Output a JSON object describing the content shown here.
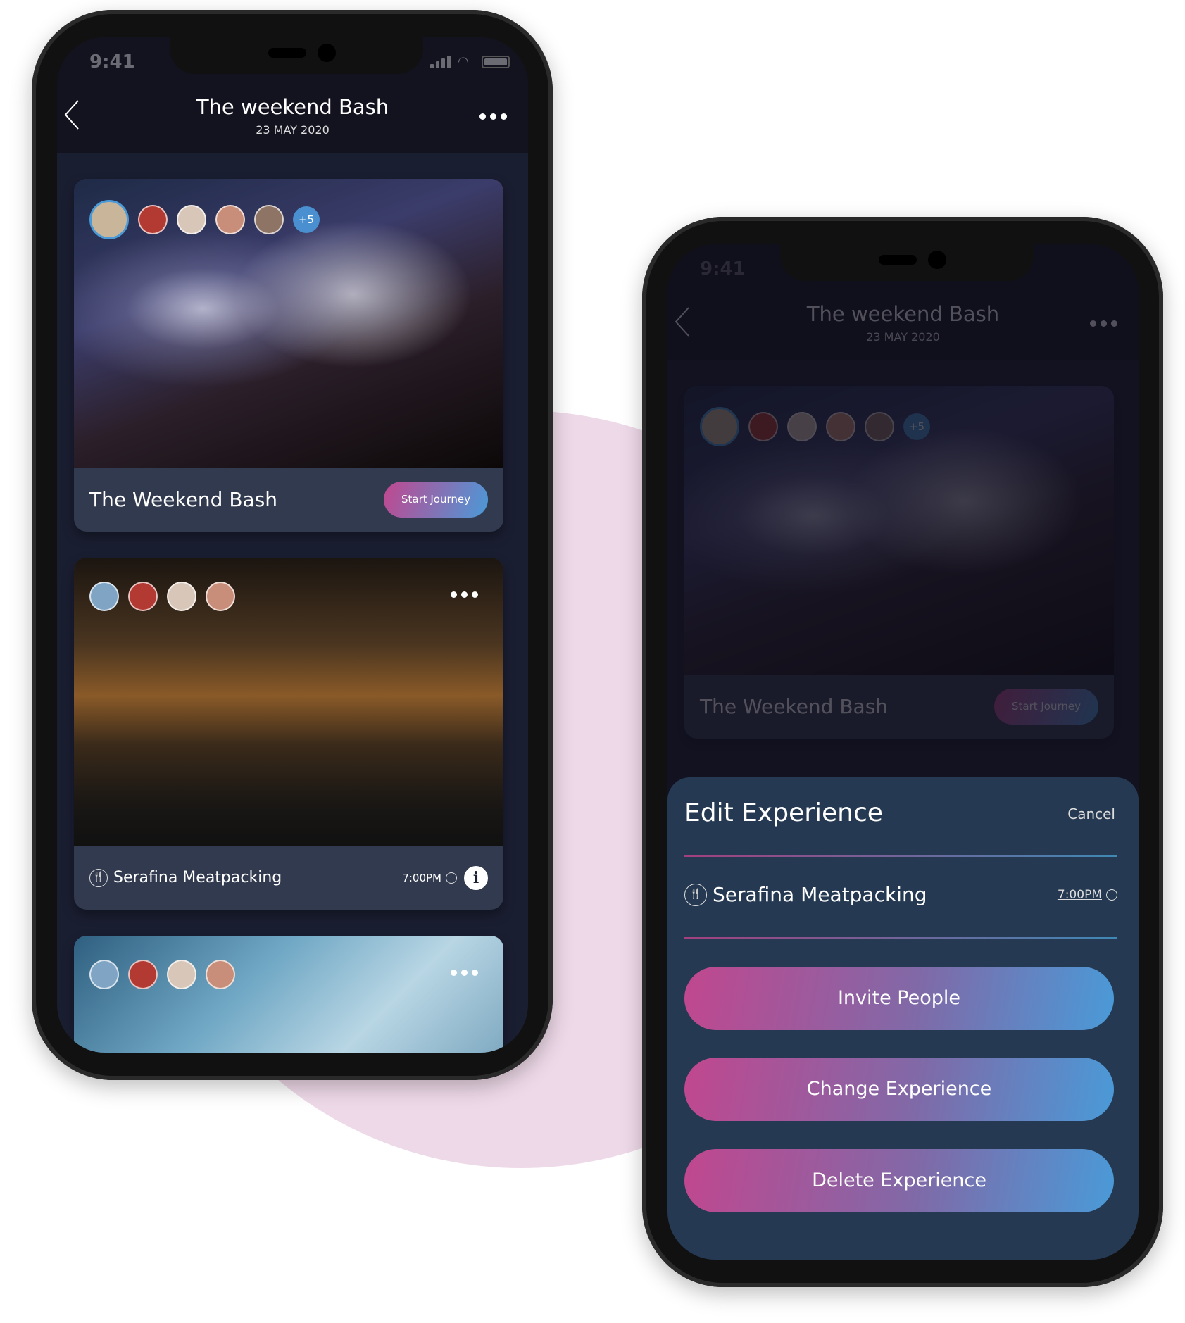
{
  "status": {
    "time": "9:41"
  },
  "header": {
    "title": "The weekend Bash",
    "date": "23 MAY 2020"
  },
  "cards": [
    {
      "title": "The Weekend Bash",
      "button": "Start Journey",
      "extra_count": "+5"
    },
    {
      "venue": "Serafina Meatpacking",
      "time": "7:00PM"
    },
    {}
  ],
  "sheet": {
    "title": "Edit Experience",
    "cancel": "Cancel",
    "venue": "Serafina Meatpacking",
    "time": "7:00PM",
    "buttons": [
      "Invite People",
      "Change Experience",
      "Delete Experience"
    ]
  },
  "colors": {
    "accent_pink": "#c1478f",
    "accent_blue": "#4a9ad8",
    "sheet_bg": "#253a52",
    "screen_bg": "#13121f"
  }
}
